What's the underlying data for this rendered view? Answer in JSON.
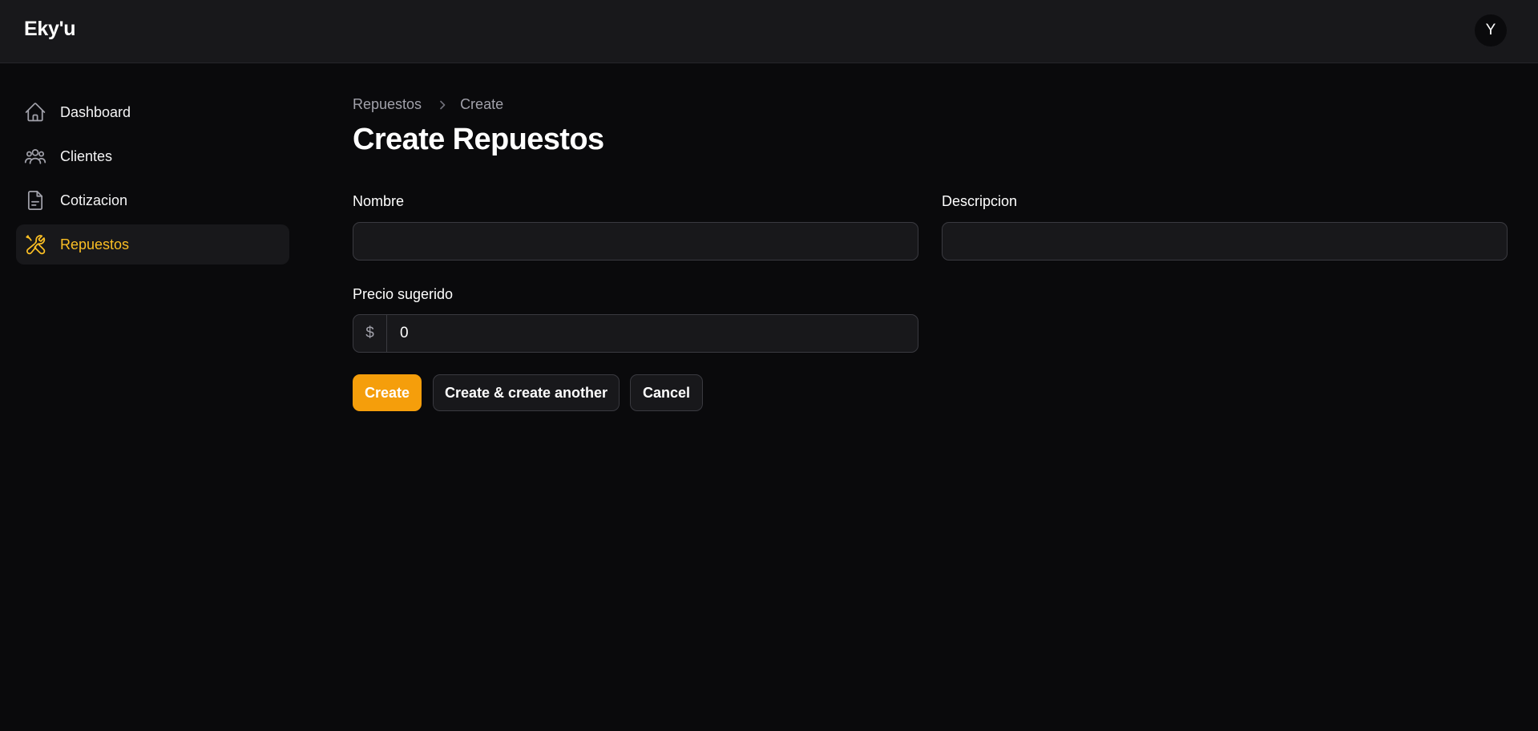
{
  "app": {
    "brand": "Eky'u",
    "user_initial": "Y"
  },
  "sidebar": {
    "items": [
      {
        "label": "Dashboard",
        "icon": "home-icon",
        "active": false
      },
      {
        "label": "Clientes",
        "icon": "users-icon",
        "active": false
      },
      {
        "label": "Cotizacion",
        "icon": "document-icon",
        "active": false
      },
      {
        "label": "Repuestos",
        "icon": "wrench-screwdriver-icon",
        "active": true
      }
    ]
  },
  "breadcrumb": {
    "items": [
      "Repuestos",
      "Create"
    ]
  },
  "page": {
    "title": "Create Repuestos"
  },
  "form": {
    "nombre": {
      "label": "Nombre",
      "value": ""
    },
    "descripcion": {
      "label": "Descripcion",
      "value": ""
    },
    "precio": {
      "label": "Precio sugerido",
      "prefix": "$",
      "value": "0"
    }
  },
  "actions": {
    "create": "Create",
    "create_another": "Create & create another",
    "cancel": "Cancel"
  },
  "colors": {
    "accent": "#f59e0b",
    "active_text": "#fbbf24",
    "background": "#0a0a0c",
    "surface": "#18181b"
  }
}
